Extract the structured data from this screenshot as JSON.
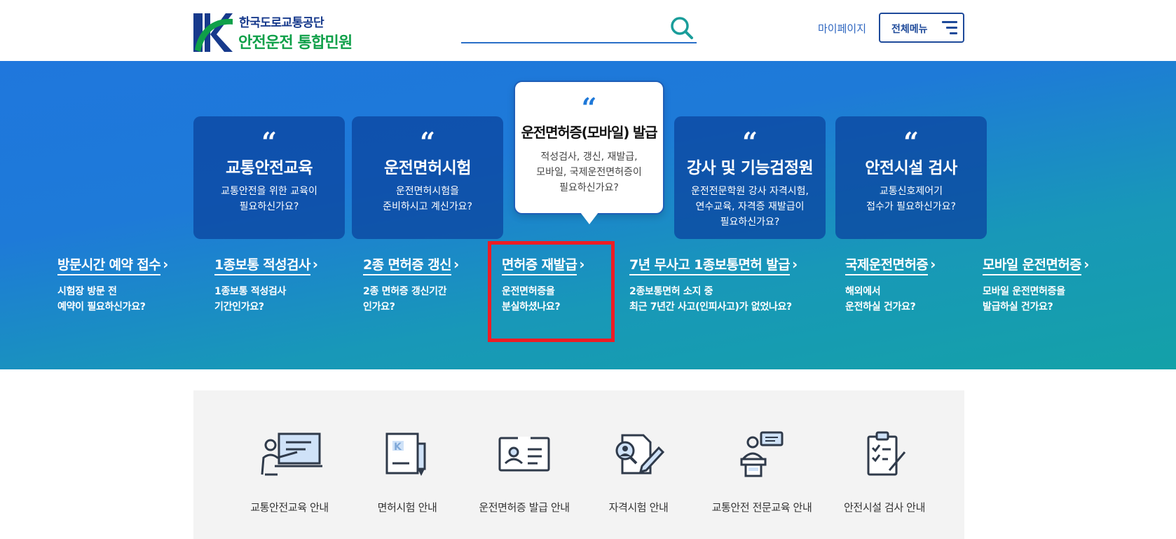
{
  "header": {
    "org_name": "한국도로교통공단",
    "site_title": "안전운전 통합민원",
    "search_placeholder": "",
    "mypage_label": "마이페이지",
    "allmenu_label": "전체메뉴"
  },
  "hero_cards": [
    {
      "quote": "“",
      "title": "교통안전교육",
      "desc": "교통안전을 위한 교육이\n필요하신가요?"
    },
    {
      "quote": "“",
      "title": "운전면허시험",
      "desc": "운전면허시험을\n준비하시고 계신가요?"
    },
    {
      "quote": "“",
      "title": "운전면허증(모바일) 발급",
      "desc": "적성검사, 갱신, 재발급,\n모바일, 국제운전면허증이\n필요하신가요?"
    },
    {
      "quote": "“",
      "title": "강사 및 기능검정원",
      "desc": "운전전문학원 강사 자격시험,\n연수교육, 자격증 재발급이\n필요하신가요?"
    },
    {
      "quote": "“",
      "title": "안전시설 검사",
      "desc": "교통신호제어기\n접수가 필요하신가요?"
    }
  ],
  "hero_links": [
    {
      "title": "방문시간 예약 접수",
      "arrow": "›",
      "desc": "시험장 방문 전\n예약이 필요하신가요?"
    },
    {
      "title": "1종보통 적성검사",
      "arrow": "›",
      "desc": "1종보통 적성검사\n기간인가요?"
    },
    {
      "title": "2종 면허증 갱신",
      "arrow": "›",
      "desc": "2종 면허증 갱신기간\n인가요?"
    },
    {
      "title": "면허증 재발급",
      "arrow": "›",
      "desc": "운전면허증을\n분실하셨나요?"
    },
    {
      "title": "7년 무사고 1종보통면허 발급",
      "arrow": "›",
      "desc": "2종보통면허 소지 중\n최근 7년간 사고(인피사고)가 없었나요?"
    },
    {
      "title": "국제운전면허증",
      "arrow": "›",
      "desc": "해외에서\n운전하실 건가요?"
    },
    {
      "title": "모바일 운전면허증",
      "arrow": "›",
      "desc": "모바일 운전면허증을\n발급하실 건가요?"
    }
  ],
  "services": [
    {
      "label": "교통안전교육 안내",
      "icon": "lecture-icon"
    },
    {
      "label": "면허시험 안내",
      "icon": "document-pen-icon"
    },
    {
      "label": "운전면허증 발급 안내",
      "icon": "id-card-icon"
    },
    {
      "label": "자격시험 안내",
      "icon": "exam-icon"
    },
    {
      "label": "교통안전 전문교육 안내",
      "icon": "speaker-icon"
    },
    {
      "label": "안전시설 검사 안내",
      "icon": "checklist-icon"
    }
  ],
  "colors": {
    "brand_navy": "#173a8c",
    "brand_green": "#0fa049",
    "accent_blue": "#2e66c0",
    "highlight_red": "#ee1c24"
  }
}
